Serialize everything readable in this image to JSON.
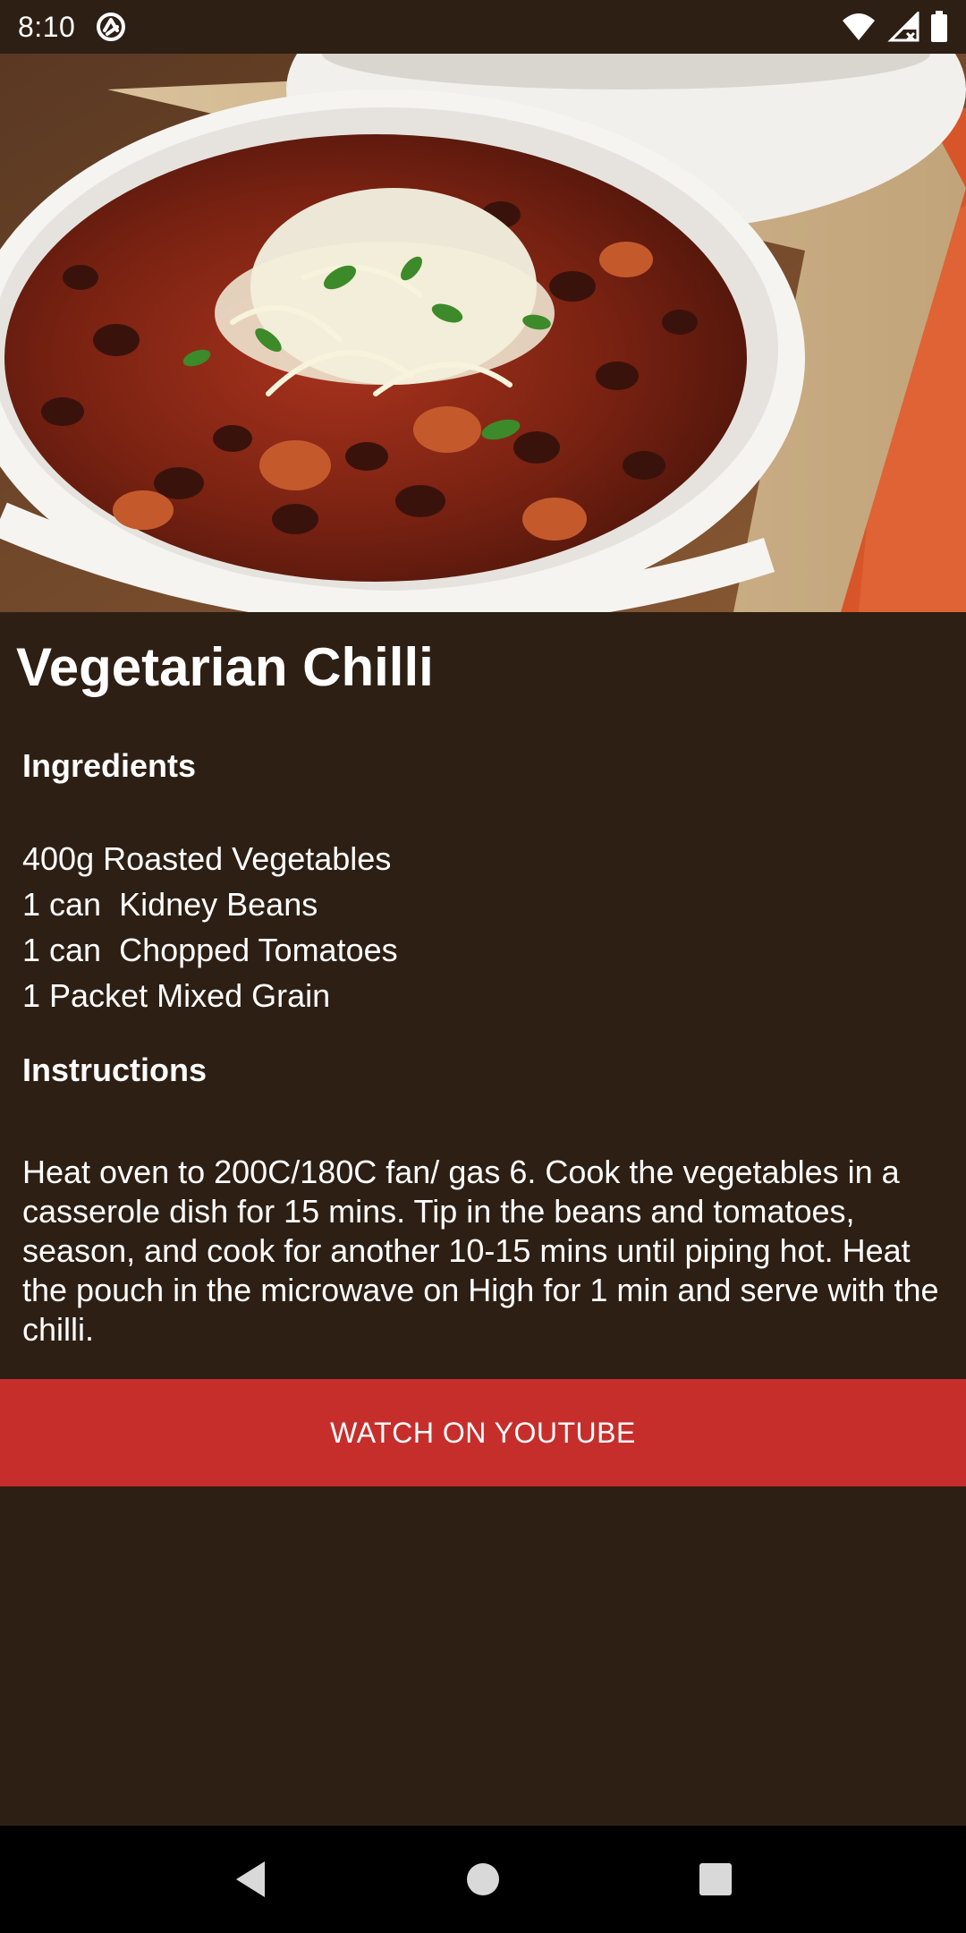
{
  "status_bar": {
    "time": "8:10",
    "icons": [
      "sync-icon",
      "wifi-icon",
      "cell-signal-icon",
      "battery-icon"
    ]
  },
  "hero": {
    "icon": "recipe-photo"
  },
  "recipe": {
    "title": "Vegetarian Chilli",
    "ingredients_heading": "Ingredients",
    "ingredients": [
      "400g Roasted Vegetables",
      "1 can  Kidney Beans",
      "1 can  Chopped Tomatoes",
      "1 Packet Mixed Grain"
    ],
    "instructions_heading": "Instructions",
    "instructions": "Heat oven to 200C/180C fan/ gas 6. Cook the vegetables in a casserole dish for 15 mins. Tip in the beans and tomatoes, season, and cook for another 10-15 mins until piping hot. Heat the pouch in the microwave on High for 1 min and serve with the chilli."
  },
  "actions": {
    "youtube_label": "WATCH ON YOUTUBE"
  },
  "nav": {
    "icons": [
      "back-icon",
      "home-icon",
      "recents-icon"
    ]
  },
  "colors": {
    "background": "#2d1f14",
    "accent": "#c62e2c",
    "text": "#ffffff",
    "nav_bar": "#000000"
  }
}
